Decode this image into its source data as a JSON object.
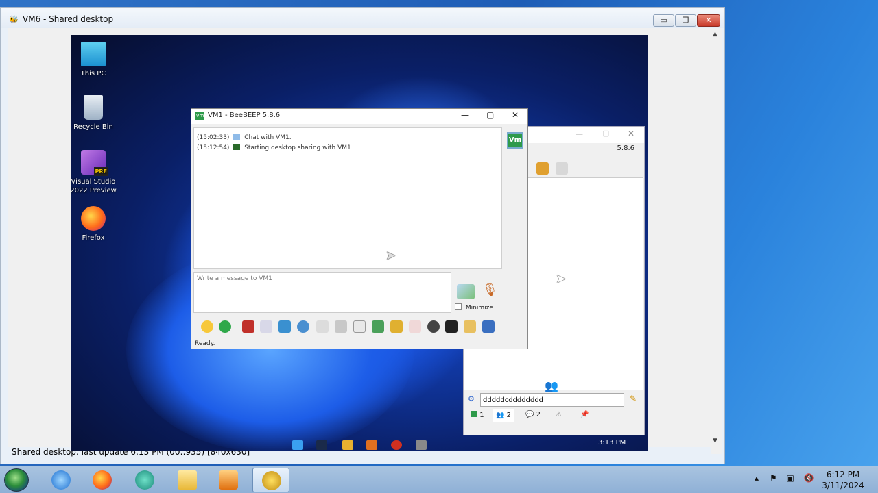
{
  "outer_window": {
    "title": "VM6 - Shared desktop",
    "status": "Shared desktop: last update 6:13 PM (00::935) [840x630]",
    "controls": {
      "minimize": "▭",
      "maximize": "❐",
      "close": "✕"
    }
  },
  "remote_desktop": {
    "icons": [
      {
        "label": "This PC"
      },
      {
        "label": "Recycle Bin"
      },
      {
        "label": "Visual Studio 2022 Preview",
        "badge": "PRE"
      },
      {
        "label": "Firefox"
      }
    ],
    "taskbar_clock": "3:13 PM"
  },
  "beebeep_main": {
    "version": "5.8.6",
    "contact_input_value": "dddddcdddddddd",
    "tabs": [
      {
        "label": "1"
      },
      {
        "label": "2"
      },
      {
        "label": "2"
      }
    ]
  },
  "beebeep_chat": {
    "title": "VM1 - BeeBEEP 5.8.6",
    "logo": "Vm",
    "side_avatar": "Vm",
    "messages": [
      {
        "time": "(15:02:33)",
        "text": "Chat with VM1."
      },
      {
        "time": "(15:12:54)",
        "text": "Starting desktop sharing with VM1"
      }
    ],
    "input_placeholder": "Write a message to VM1",
    "minimize_label": "Minimize",
    "status": "Ready."
  },
  "host_taskbar": {
    "time": "6:12 PM",
    "date": "3/11/2024"
  },
  "colors": {
    "beebeep_green": "#2e9a4a",
    "win7_taskbar": "#9fbde0"
  }
}
